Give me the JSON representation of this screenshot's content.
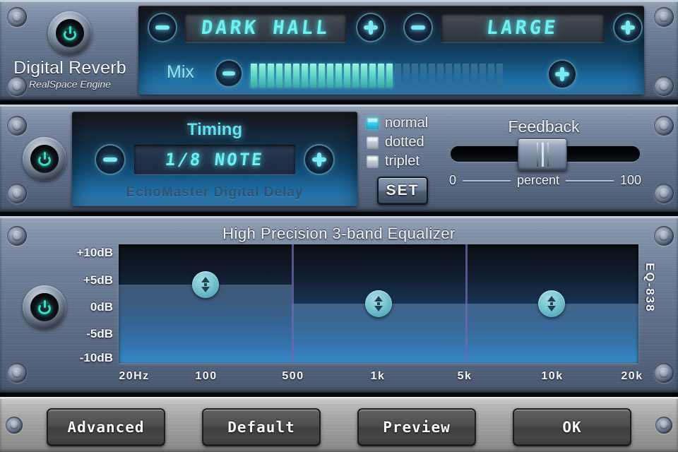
{
  "reverb": {
    "title": "Digital Reverb",
    "subtitle": "RealSpace Engine",
    "preset_value": "DARK HALL",
    "size_value": "LARGE",
    "mix_label": "Mix",
    "preset_dec": "minus-icon",
    "preset_inc": "plus-icon",
    "size_dec": "minus-icon",
    "size_inc": "plus-icon",
    "mix_dec": "minus-icon",
    "mix_inc": "plus-icon",
    "mix_segments_total": 30,
    "mix_segments_on": 17
  },
  "delay": {
    "section_title": "Timing",
    "timing_value": "1/8 NOTE",
    "brand": "EchoMaster Digital Delay",
    "timing_dec": "minus-icon",
    "timing_inc": "plus-icon",
    "modes": [
      {
        "label": "normal",
        "checked": true
      },
      {
        "label": "dotted",
        "checked": false
      },
      {
        "label": "triplet",
        "checked": false
      }
    ],
    "set_label": "SET",
    "feedback": {
      "title": "Feedback",
      "min_label": "0",
      "unit_label": "percent",
      "max_label": "100",
      "value": 50
    }
  },
  "eq": {
    "title": "High Precision 3-band Equalizer",
    "model": "EQ-838",
    "db_labels": [
      "+10dB",
      "+5dB",
      "0dB",
      "-5dB",
      "-10dB"
    ],
    "freq_labels": [
      "20Hz",
      "100",
      "500",
      "1k",
      "5k",
      "10k",
      "20k"
    ],
    "bands": [
      {
        "name": "low",
        "gain_db": 4
      },
      {
        "name": "mid",
        "gain_db": 0
      },
      {
        "name": "high",
        "gain_db": 0
      }
    ]
  },
  "footer": {
    "buttons": [
      {
        "label": "Advanced"
      },
      {
        "label": "Default"
      },
      {
        "label": "Preview"
      },
      {
        "label": "OK"
      }
    ]
  },
  "colors": {
    "accent_cyan": "#6ff0f0",
    "accent_teal": "#5fd8c8",
    "power_green": "#2fe3c8",
    "panel_blue": "#60718c"
  }
}
